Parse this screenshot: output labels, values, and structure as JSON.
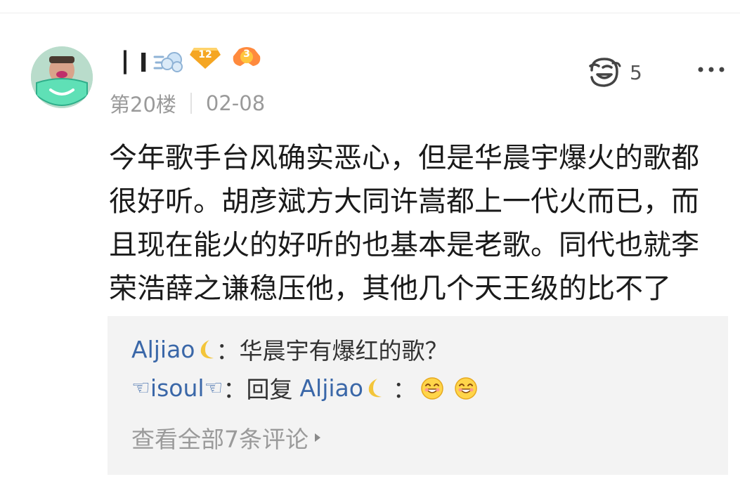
{
  "post": {
    "username": "丨l",
    "level": "12",
    "fan_level": "3",
    "floor": "第20楼",
    "date": "02-08",
    "like_count": "5",
    "content_lines": [
      "今年歌手台风确实恶心，但是华晨宇爆火的歌都",
      "很好听。胡彦斌方大同许嵩都上一代火而已，而",
      "且现在能火的好听的也基本是老歌。同代也就李",
      "荣浩薛之谦稳压他，其他几个天王级的比不了"
    ]
  },
  "replies": [
    {
      "author": "Aljiao",
      "colon": "：",
      "text": "华晨宇有爆红的歌？"
    },
    {
      "author_prefix": "☜",
      "author": "isoul",
      "author_suffix": "☜",
      "colon": "：",
      "reply_word": "回复",
      "reply_to": "Aljiao",
      "text": "："
    }
  ],
  "view_all": "查看全部7条评论",
  "icons": {
    "avatar": "masked-face-avatar",
    "username_emoji": "dashing-away-icon",
    "level_badge": "level-diamond-badge-icon",
    "fan_badge": "fan-badge-icon",
    "like": "like-face-icon",
    "more": "more-dots-icon",
    "moon": "crescent-moon-icon",
    "hand": "pointing-hand-icon",
    "grin": "grinning-emoji-icon",
    "caret": "caret-right-icon"
  },
  "colors": {
    "link": "#3a67a8",
    "meta": "#9a9a9a",
    "reply_bg": "#f3f3f3",
    "level_badge": "#f5a623",
    "fan_badge": "#ff8a3d"
  }
}
